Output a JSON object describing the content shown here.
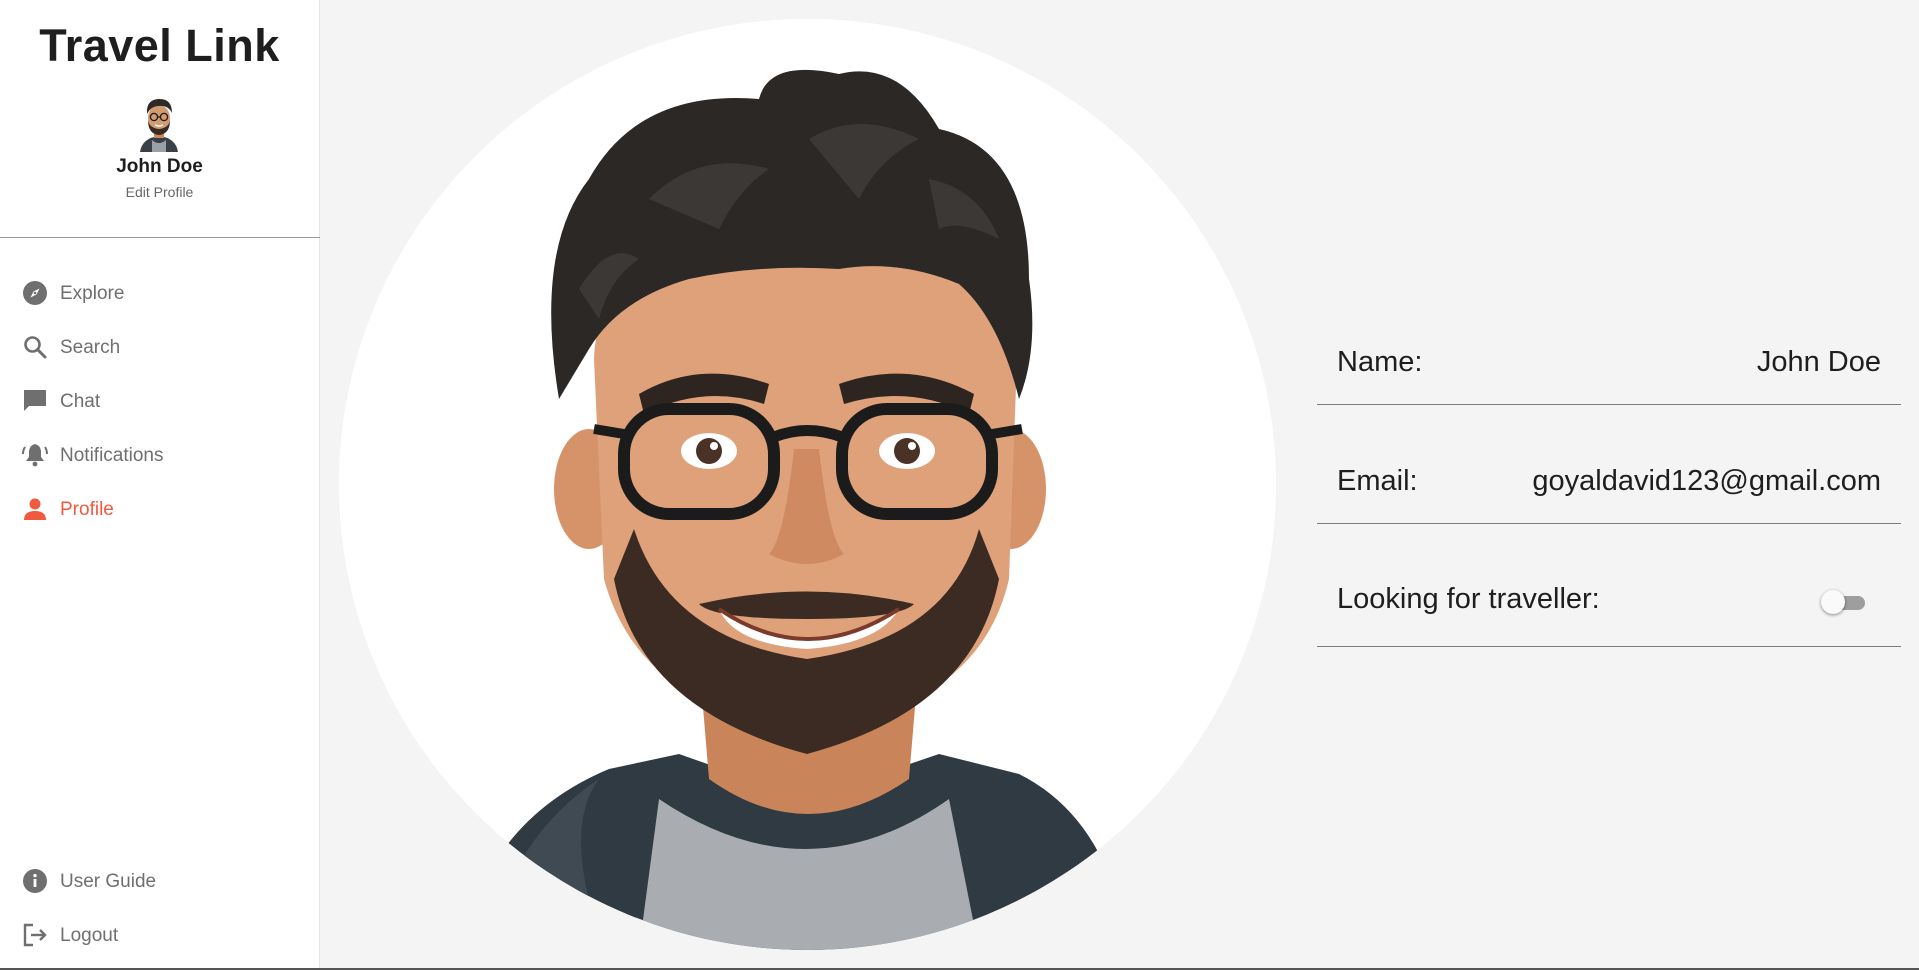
{
  "app": {
    "title": "Travel Link"
  },
  "user": {
    "name": "John Doe",
    "edit_label": "Edit Profile"
  },
  "nav": {
    "items": [
      {
        "label": "Explore",
        "icon": "compass-icon"
      },
      {
        "label": "Search",
        "icon": "search-icon"
      },
      {
        "label": "Chat",
        "icon": "chat-icon"
      },
      {
        "label": "Notifications",
        "icon": "bell-icon"
      },
      {
        "label": "Profile",
        "icon": "person-icon",
        "active": true
      }
    ],
    "bottom": [
      {
        "label": "User Guide",
        "icon": "info-icon"
      },
      {
        "label": "Logout",
        "icon": "logout-icon"
      }
    ]
  },
  "profile": {
    "name_label": "Name:",
    "name_value": "John Doe",
    "email_label": "Email:",
    "email_value": "goyaldavid123@gmail.com",
    "looking_label": "Looking for traveller:",
    "looking_value": false
  },
  "colors": {
    "accent": "#f05a3e",
    "nav_text": "#6f6f6f",
    "background": "#f4f4f4"
  }
}
